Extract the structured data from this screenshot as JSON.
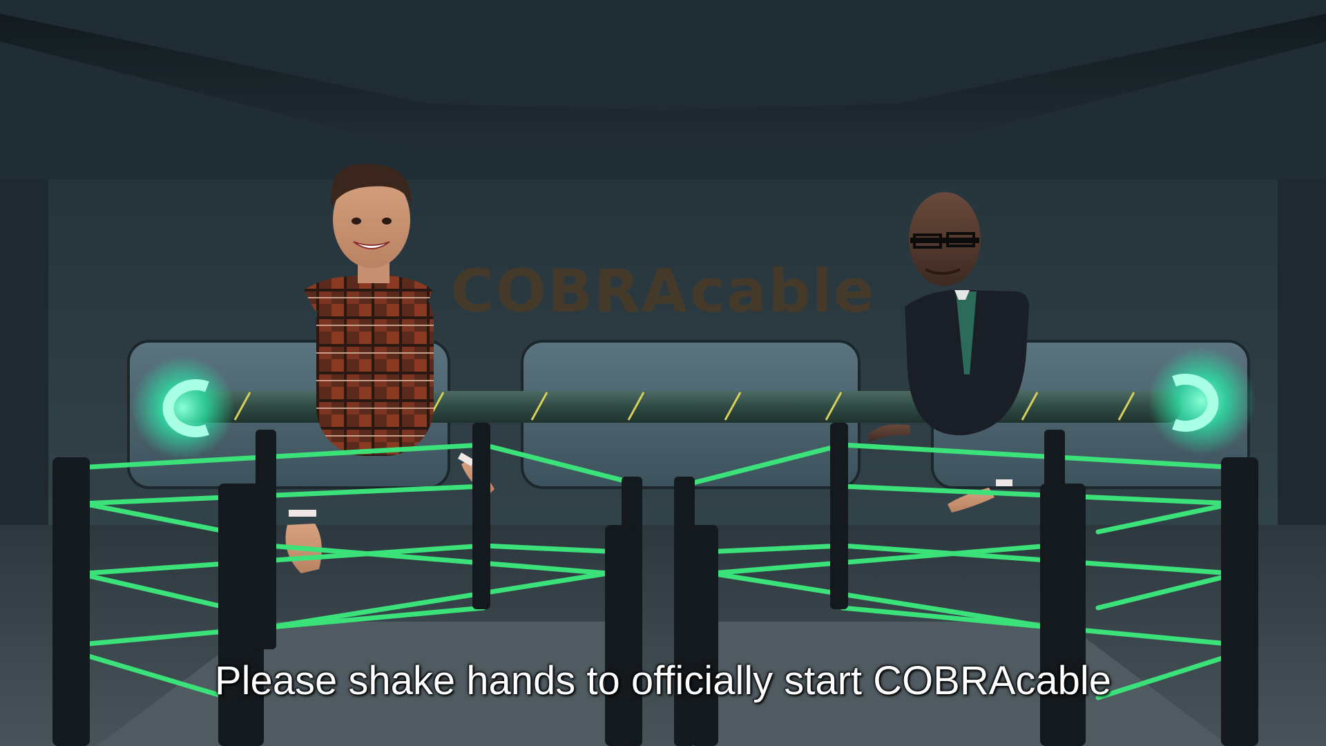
{
  "scene": {
    "wall_logo": {
      "upper": "COBRA",
      "lower": "cable"
    },
    "subtitle": "Please shake hands to officially start COBRAcable",
    "colors": {
      "room": "#1c2b33",
      "ring_glow": "#39e07a",
      "cable_glow": "#33f0b0",
      "logo": "#4a3a27",
      "subtitle": "#ffffff"
    }
  }
}
